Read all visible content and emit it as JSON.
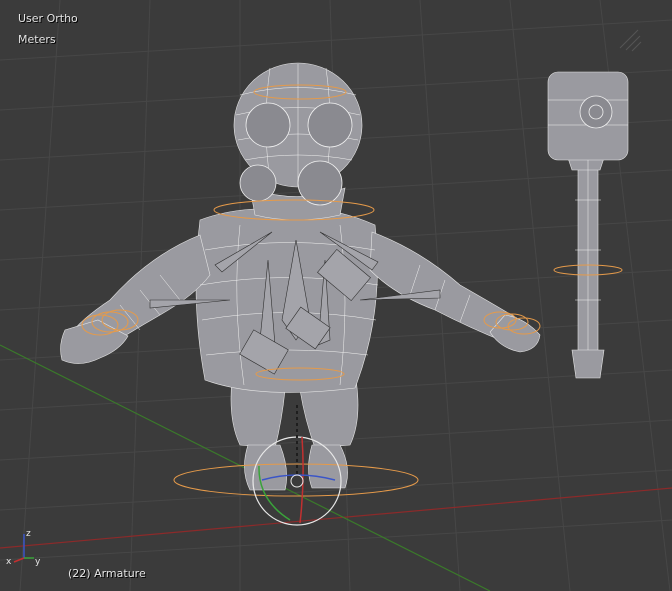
{
  "viewport": {
    "view_name": "User Ortho",
    "units": "Meters",
    "object_info": "(22) Armature"
  },
  "gizmo": {
    "x_label": "x",
    "y_label": "y",
    "z_label": "z"
  },
  "colors": {
    "background": "#3b3b3b",
    "grid": "#4a4a4a",
    "x_axis": "#8c2a2a",
    "y_axis": "#3a7a2a",
    "mesh_fill": "#9a9a9e",
    "mesh_wire": "#e8e8e8",
    "selection": "#e59a4a"
  }
}
